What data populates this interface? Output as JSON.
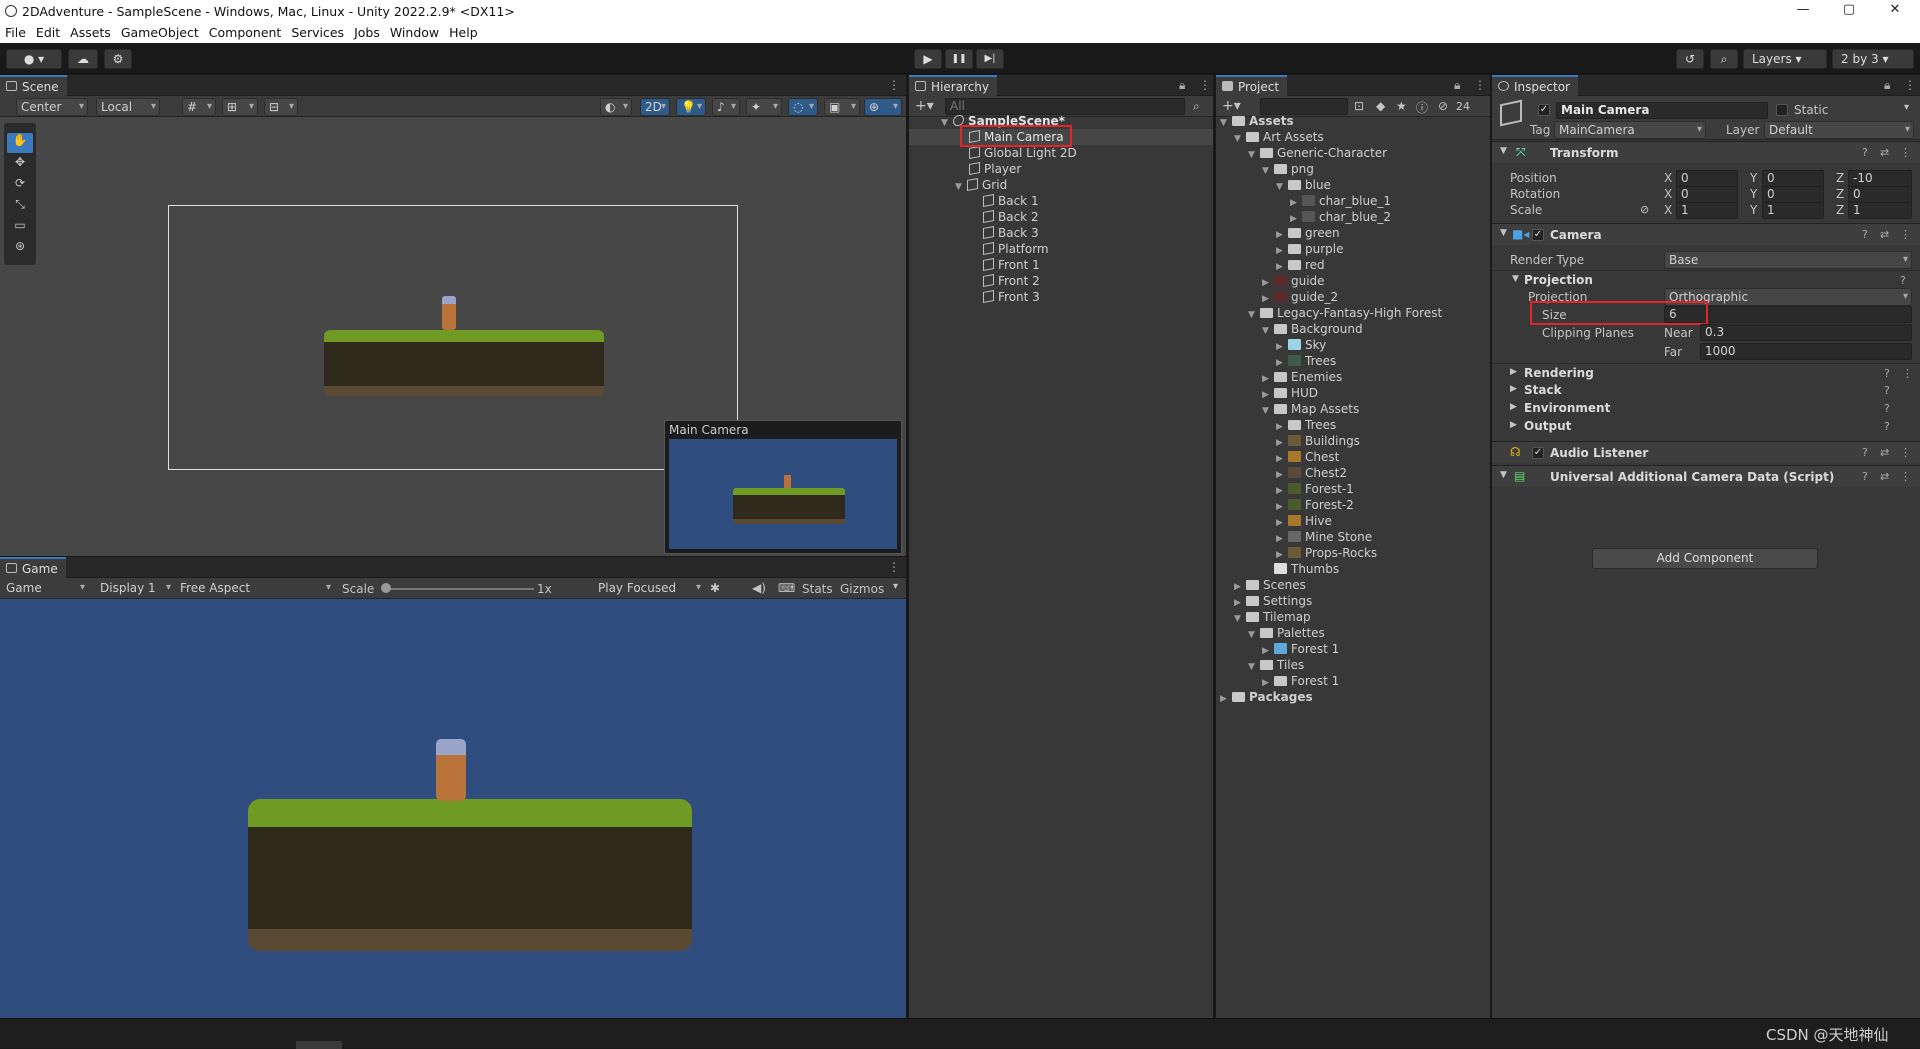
{
  "window": {
    "title": "2DAdventure - SampleScene - Windows, Mac, Linux - Unity 2022.2.9* <DX11>",
    "min": "—",
    "max": "▢",
    "close": "✕"
  },
  "menu": [
    "File",
    "Edit",
    "Assets",
    "GameObject",
    "Component",
    "Services",
    "Jobs",
    "Window",
    "Help"
  ],
  "toolbar": {
    "layers": "Layers",
    "layout": "2 by 3",
    "play": "▶",
    "pause": "❚❚",
    "step": "▶|"
  },
  "scene": {
    "tab": "Scene",
    "pivot": "Center",
    "space": "Local",
    "mode2d": "2D",
    "cam_preview": "Main Camera"
  },
  "game": {
    "tab": "Game",
    "display_mode": "Game",
    "display": "Display 1",
    "aspect": "Free Aspect",
    "scale_label": "Scale",
    "scale_value": "1x",
    "play_mode": "Play Focused",
    "stats": "Stats",
    "gizmos": "Gizmos"
  },
  "hierarchy": {
    "tab": "Hierarchy",
    "search_placeholder": "All",
    "scene": "SampleScene*",
    "items": [
      "Main Camera",
      "Global Light 2D",
      "Player",
      "Grid",
      "Back 1",
      "Back 2",
      "Back 3",
      "Platform",
      "Front 1",
      "Front 2",
      "Front 3"
    ]
  },
  "project": {
    "tab": "Project",
    "hidden_count": "24",
    "items": [
      "Assets",
      "Art Assets",
      "Generic-Character",
      "png",
      "blue",
      "char_blue_1",
      "char_blue_2",
      "green",
      "purple",
      "red",
      "guide",
      "guide_2",
      "Legacy-Fantasy-High Forest",
      "Background",
      "Sky",
      "Trees",
      "Enemies",
      "HUD",
      "Map Assets",
      "Trees",
      "Buildings",
      "Chest",
      "Chest2",
      "Forest-1",
      "Forest-2",
      "Hive",
      "Mine Stone",
      "Props-Rocks",
      "Thumbs",
      "Scenes",
      "Settings",
      "Tilemap",
      "Palettes",
      "Forest 1",
      "Tiles",
      "Forest 1",
      "Packages"
    ]
  },
  "inspector": {
    "tab": "Inspector",
    "object_name": "Main Camera",
    "static": "Static",
    "tag_label": "Tag",
    "tag": "MainCamera",
    "layer_label": "Layer",
    "layer": "Default",
    "transform": {
      "title": "Transform",
      "position": "Position",
      "rotation": "Rotation",
      "scale": "Scale",
      "pos": [
        "0",
        "0",
        "-10"
      ],
      "rot": [
        "0",
        "0",
        "0"
      ],
      "scl": [
        "1",
        "1",
        "1"
      ],
      "axes": [
        "X",
        "Y",
        "Z"
      ]
    },
    "camera": {
      "title": "Camera",
      "render_type_label": "Render Type",
      "render_type": "Base",
      "projection_section": "Projection",
      "projection_label": "Projection",
      "projection": "Orthographic",
      "size_label": "Size",
      "size": "6",
      "clipping": "Clipping Planes",
      "near_label": "Near",
      "near": "0.3",
      "far_label": "Far",
      "far": "1000",
      "sections": [
        "Rendering",
        "Stack",
        "Environment",
        "Output"
      ]
    },
    "audio": "Audio Listener",
    "urp": "Universal Additional Camera Data (Script)",
    "add_component": "Add Component"
  },
  "watermark": "CSDN @天地神仙",
  "colors": {
    "accent": "#3a79bb",
    "highlight": "#e0262a",
    "game_bg": "#2f4e7f"
  }
}
